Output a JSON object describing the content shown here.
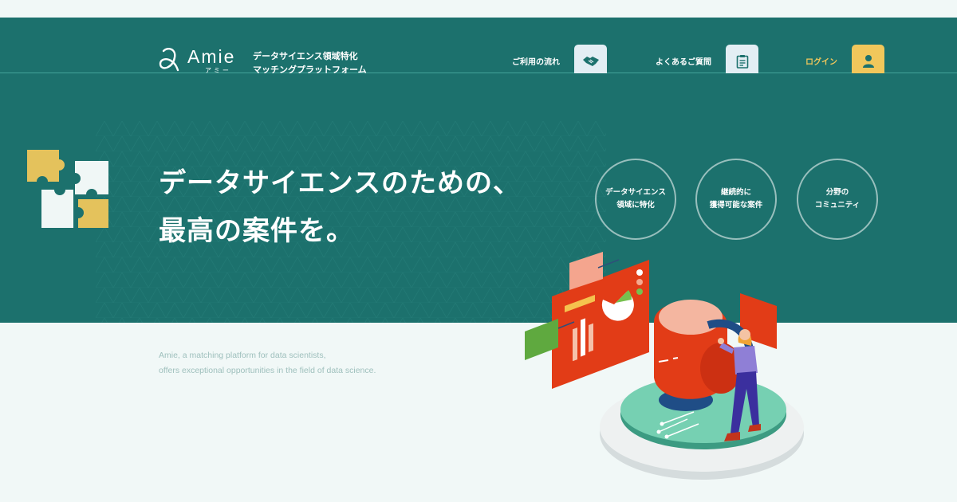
{
  "brand": {
    "name": "Amie",
    "name_kana": "アミー",
    "tagline_line1": "データサイエンス領域特化",
    "tagline_line2": "マッチングプラットフォーム"
  },
  "nav": {
    "flow_label": "ご利用の流れ",
    "faq_label": "よくあるご質問",
    "login_label": "ログイン"
  },
  "hero": {
    "headline_line1": "データサイエンスのための、",
    "headline_line2": "最高の案件を。",
    "badges": [
      {
        "line1": "データサイエンス",
        "line2": "領域に特化"
      },
      {
        "line1": "継続的に",
        "line2": "獲得可能な案件"
      },
      {
        "line1": "分野の",
        "line2": "コミュニティ"
      }
    ]
  },
  "description": {
    "line1": "Amie, a matching platform for data scientists,",
    "line2": "offers exceptional opportunities in the field of data science."
  },
  "colors": {
    "primary": "#1c716d",
    "accent_yellow": "#f1c75b",
    "background": "#f1f8f7",
    "illustration_red": "#e03a16"
  },
  "icons": {
    "flow": "handshake-icon",
    "faq": "clipboard-icon",
    "login": "user-icon"
  }
}
